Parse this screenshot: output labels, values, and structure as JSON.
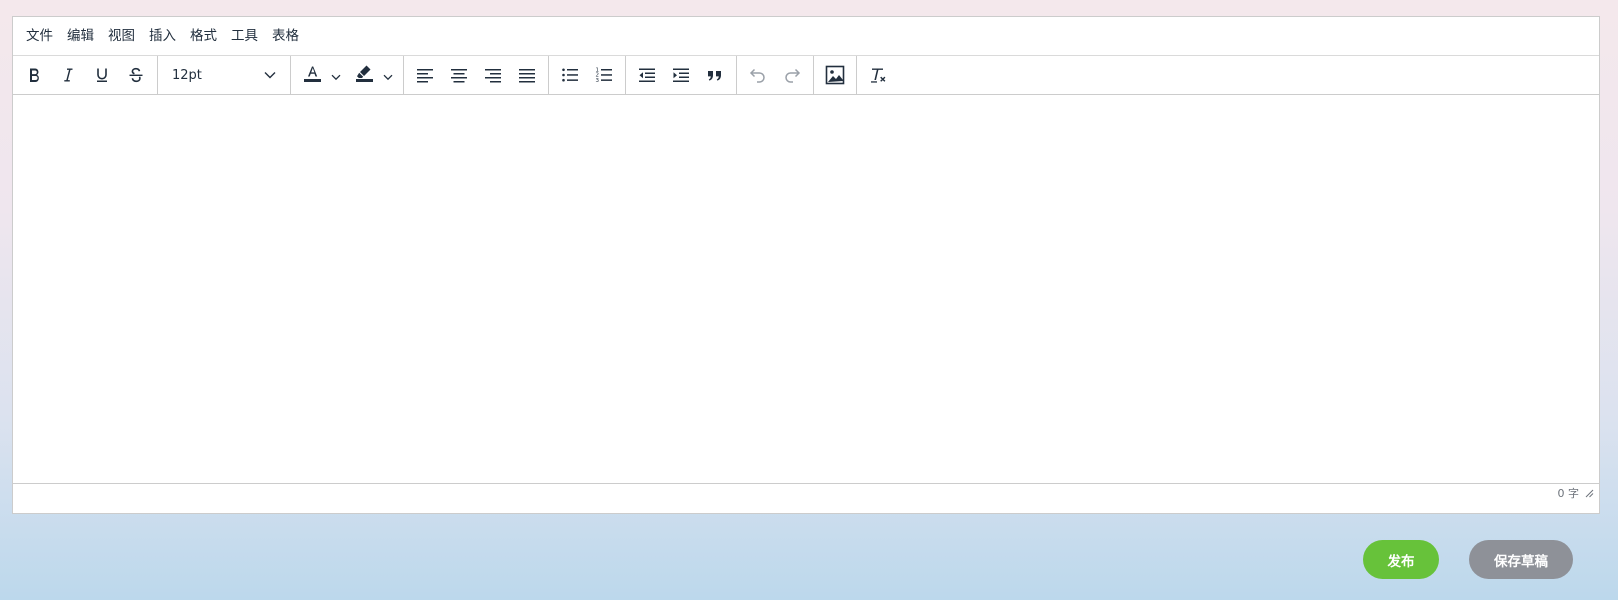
{
  "menubar": {
    "items": [
      "文件",
      "编辑",
      "视图",
      "插入",
      "格式",
      "工具",
      "表格"
    ]
  },
  "toolbar": {
    "font_size": "12pt",
    "icons": [
      "bold-icon",
      "italic-icon",
      "underline-icon",
      "strikethrough-icon",
      "text-color-icon",
      "highlight-color-icon",
      "align-left-icon",
      "align-center-icon",
      "align-right-icon",
      "align-justify-icon",
      "bullet-list-icon",
      "numbered-list-icon",
      "outdent-icon",
      "indent-icon",
      "blockquote-icon",
      "undo-icon",
      "redo-icon",
      "image-icon",
      "clear-formatting-icon"
    ],
    "text_color": "#222f3e",
    "highlight_color": "#222f3e"
  },
  "editor": {
    "content": ""
  },
  "statusbar": {
    "word_count": "0 字"
  },
  "actions": {
    "publish_label": "发布",
    "save_draft_label": "保存草稿",
    "publish_color": "#67c23a",
    "save_draft_color": "#8e9198"
  }
}
